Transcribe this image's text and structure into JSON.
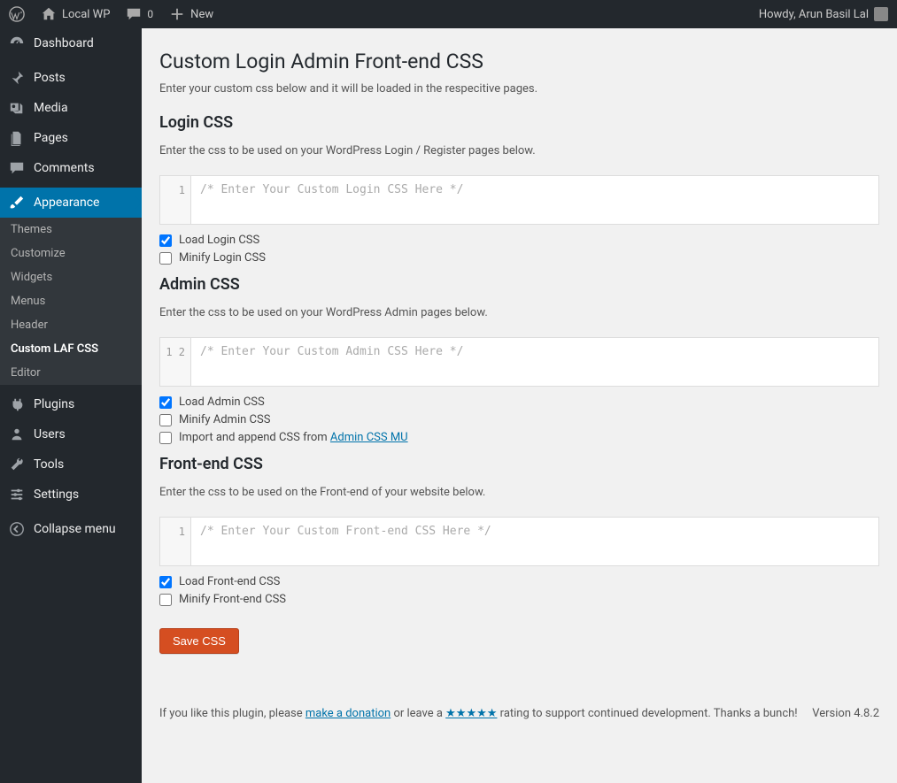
{
  "adminbar": {
    "site_name": "Local WP",
    "comment_count": "0",
    "new_label": "New",
    "howdy": "Howdy, Arun Basil Lal"
  },
  "sidebar": {
    "dashboard": "Dashboard",
    "posts": "Posts",
    "media": "Media",
    "pages": "Pages",
    "comments": "Comments",
    "appearance": "Appearance",
    "submenu": {
      "themes": "Themes",
      "customize": "Customize",
      "widgets": "Widgets",
      "menus": "Menus",
      "header": "Header",
      "custom_laf": "Custom LAF CSS",
      "editor": "Editor"
    },
    "plugins": "Plugins",
    "users": "Users",
    "tools": "Tools",
    "settings": "Settings",
    "collapse": "Collapse menu"
  },
  "page": {
    "title": "Custom Login Admin Front-end CSS",
    "intro": "Enter your custom css below and it will be loaded in the respecitive pages.",
    "login": {
      "heading": "Login CSS",
      "desc": "Enter the css to be used on your WordPress Login / Register pages below.",
      "placeholder": "/* Enter Your Custom Login CSS Here */",
      "lines": "1",
      "load_label": "Load Login CSS",
      "minify_label": "Minify Login CSS"
    },
    "admin": {
      "heading": "Admin CSS",
      "desc": "Enter the css to be used on your WordPress Admin pages below.",
      "placeholder": "/* Enter Your Custom Admin CSS Here */",
      "lines": "1\n2",
      "load_label": "Load Admin CSS",
      "minify_label": "Minify Admin CSS",
      "import_prefix": "Import and append CSS from ",
      "import_link": "Admin CSS MU"
    },
    "frontend": {
      "heading": "Front-end CSS",
      "desc": "Enter the css to be used on the Front-end of your website below.",
      "placeholder": "/* Enter Your Custom Front-end CSS Here */",
      "lines": "1",
      "load_label": "Load Front-end CSS",
      "minify_label": "Minify Front-end CSS"
    },
    "save_button": "Save CSS",
    "footer": {
      "prefix": "If you like this plugin, please ",
      "donate": "make a donation",
      "mid1": " or leave a ",
      "stars": "★★★★★",
      "mid2": " rating to support continued development. Thanks a bunch!",
      "version": "Version 4.8.2"
    }
  }
}
